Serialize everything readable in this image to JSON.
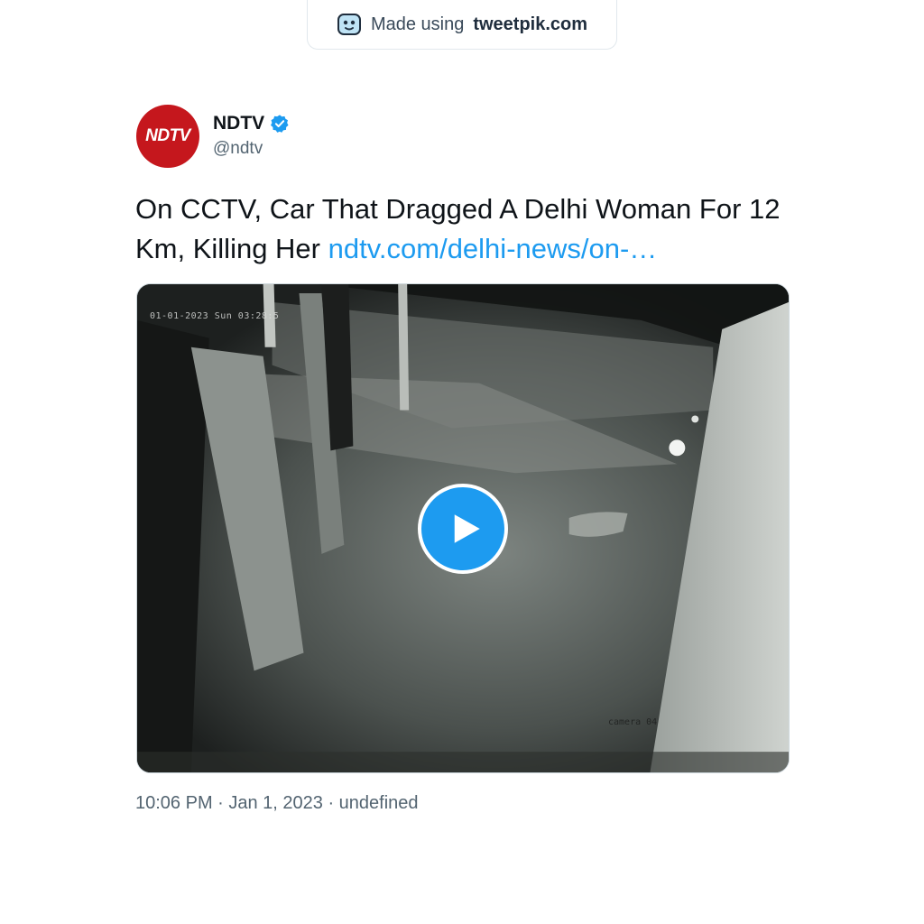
{
  "badge": {
    "prefix": "Made using",
    "brand": "tweetpik.com",
    "icon": "tweetpik-logo-icon"
  },
  "author": {
    "avatar_text": "NDTV",
    "avatar_color": "#c5171d",
    "name": "NDTV",
    "handle": "@ndtv",
    "verified": true,
    "verified_icon": "verified-badge-icon"
  },
  "tweet": {
    "text": "On CCTV, Car That Dragged A Delhi Woman For 12 Km, Killing Her ",
    "link": "ndtv.com/delhi-news/on-…",
    "link_color": "#1d9bf0"
  },
  "media": {
    "type": "video",
    "timestamp_overlay": "01-01-2023 Sun 03:28:5",
    "camera_label": "camera 04",
    "play_icon": "play-icon",
    "play_color": "#1d9bf0"
  },
  "footer": {
    "meta": "10:06 PM · Jan 1, 2023 · undefined"
  }
}
